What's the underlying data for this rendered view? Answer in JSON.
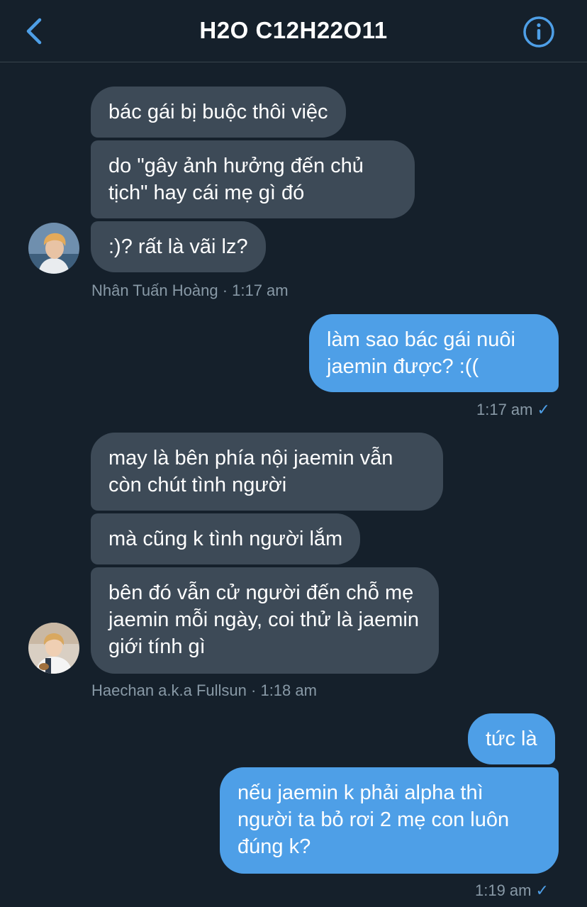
{
  "header": {
    "title": "H2O C12H22O11",
    "back_icon": "chevron-left-icon",
    "info_icon": "info-circle-icon",
    "accent_color": "#4e9fe7"
  },
  "messages": [
    {
      "text": "bác gái bị buộc thôi việc"
    },
    {
      "text": "do \"gây ảnh hưởng đến chủ tịch\" hay cái mẹ gì đó"
    },
    {
      "text": ":)? rất là vãi lz?"
    },
    {
      "text": "làm sao bác gái nuôi jaemin được? :(("
    },
    {
      "text": "may là bên phía nội jaemin vẫn còn chút tình người"
    },
    {
      "text": "mà cũng k tình người lắm"
    },
    {
      "text": "bên đó vẫn cử người đến chỗ mẹ jaemin mỗi ngày, coi thử là jaemin giới tính gì"
    },
    {
      "text": "tức là"
    },
    {
      "text": "nếu jaemin k phải alpha thì người ta bỏ rơi 2 mẹ con luôn đúng k?"
    }
  ],
  "meta": [
    {
      "text": "Nhân Tuấn Hoàng · 1:17 am"
    },
    {
      "text": "1:17 am",
      "read": "✓"
    },
    {
      "text": "Haechan a.k.a Fullsun · 1:18 am"
    },
    {
      "text": "1:19 am",
      "read": "✓"
    }
  ],
  "avatars": [
    {
      "icon": "user-avatar-nhan-tuan-hoang"
    },
    {
      "icon": "user-avatar-haechan"
    }
  ],
  "colors": {
    "background": "#15202b",
    "incoming_bubble": "#3d4a57",
    "outgoing_bubble": "#4e9fe7",
    "meta_text": "#8899a6"
  }
}
